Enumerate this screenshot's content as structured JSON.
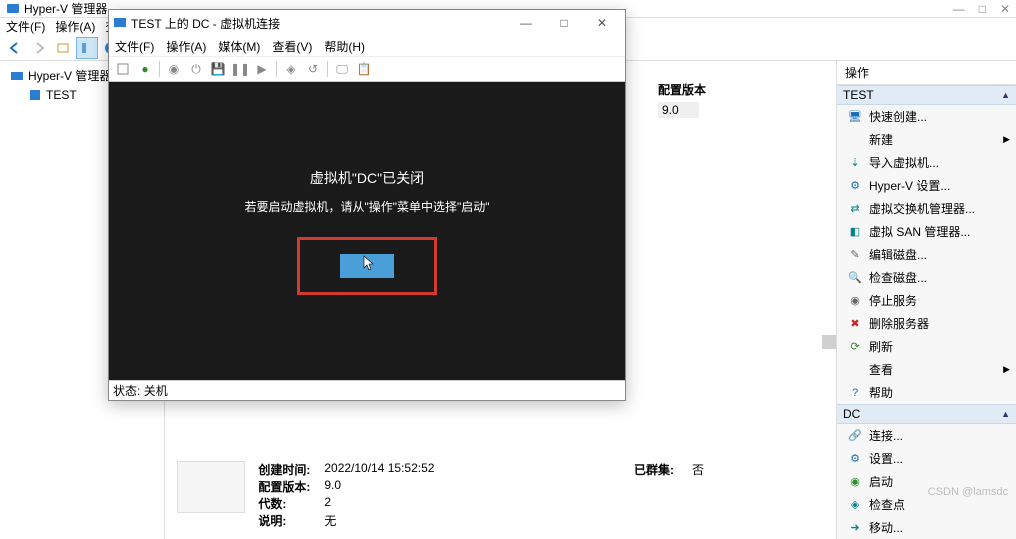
{
  "main": {
    "title": "Hyper-V 管理器",
    "menu": {
      "file": "文件(F)",
      "action": "操作(A)",
      "view": "查"
    },
    "winbtns": {
      "min": "—",
      "max": "□",
      "close": "✕"
    }
  },
  "tree": {
    "root": "Hyper-V 管理器",
    "child": "TEST"
  },
  "center": {
    "cfg_label": "配置版本",
    "cfg_value": "9.0",
    "created_label": "创建时间:",
    "created_value": "2022/10/14 15:52:52",
    "cfgver_label": "配置版本:",
    "cfgver_value": "9.0",
    "gen_label": "代数:",
    "gen_value": "2",
    "desc_label": "说明:",
    "desc_value": "无",
    "clustered_label": "已群集:",
    "clustered_value": "否"
  },
  "actions": {
    "pane_title": "操作",
    "group1": "TEST",
    "group2": "DC",
    "g1": {
      "quick_create": "快速创建...",
      "new": "新建",
      "import_vm": "导入虚拟机...",
      "hv_settings": "Hyper-V 设置...",
      "vswitch_mgr": "虚拟交换机管理器...",
      "vsan_mgr": "虚拟 SAN 管理器...",
      "edit_disk": "编辑磁盘...",
      "inspect_disk": "检查磁盘...",
      "stop_service": "停止服务",
      "remove_server": "删除服务器",
      "refresh": "刷新",
      "view": "查看",
      "help": "帮助"
    },
    "g2": {
      "connect": "连接...",
      "settings": "设置...",
      "start": "启动",
      "checkpoint": "检查点",
      "move": "移动..."
    }
  },
  "vm": {
    "title": "TEST 上的 DC - 虚拟机连接",
    "menu": {
      "file": "文件(F)",
      "action": "操作(A)",
      "media": "媒体(M)",
      "view": "查看(V)",
      "help": "帮助(H)"
    },
    "msg1": "虚拟机\"DC\"已关闭",
    "msg2": "若要启动虚拟机，请从\"操作\"菜单中选择\"启动\"",
    "start_button": "",
    "status_label": "状态:",
    "status_value": "关机"
  },
  "watermark": "CSDN @lamsdc"
}
